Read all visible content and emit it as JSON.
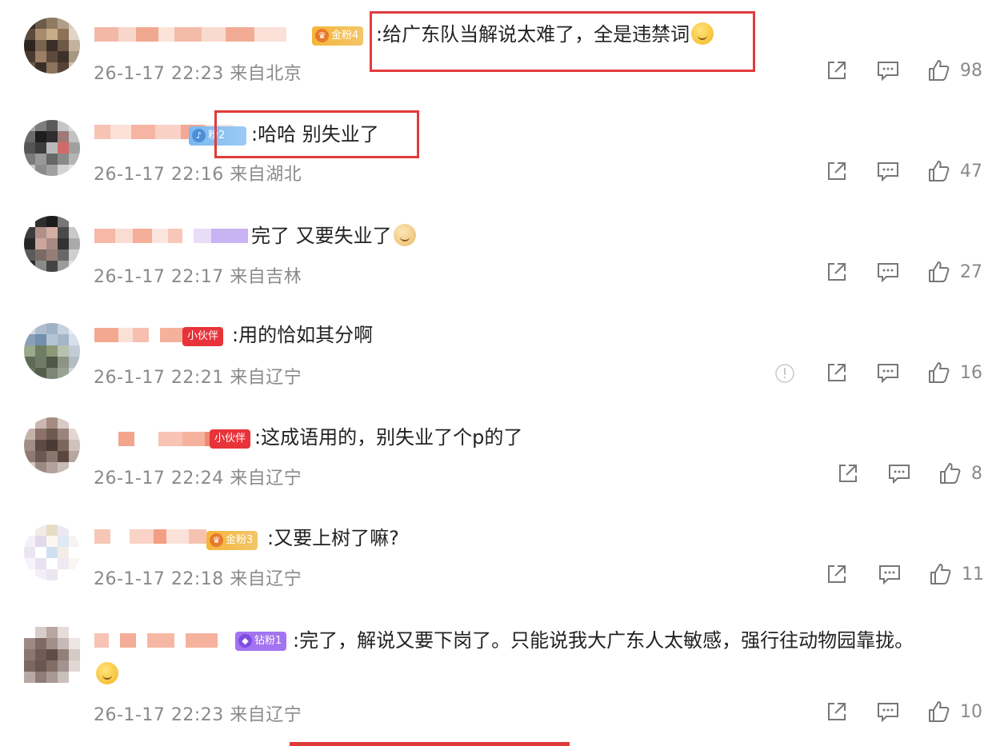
{
  "comments": [
    {
      "badge": "金粉4",
      "text": ":给广东队当解说太难了，全是违禁词",
      "time": "26-1-17 22:23",
      "location": "来自北京",
      "likes": "98"
    },
    {
      "badge": "粉2",
      "text": ":哈哈 别失业了",
      "time": "26-1-17 22:16",
      "location": "来自湖北",
      "likes": "47"
    },
    {
      "badge": "",
      "text": "完了 又要失业了",
      "time": "26-1-17 22:17",
      "location": "来自吉林",
      "likes": "27"
    },
    {
      "badge": "小伙伴",
      "text": ":用的恰如其分啊",
      "time": "26-1-17 22:21",
      "location": "来自辽宁",
      "likes": "16"
    },
    {
      "badge": "小伙伴",
      "text": ":这成语用的，别失业了个p的了",
      "time": "26-1-17 22:24",
      "location": "来自辽宁",
      "likes": "8"
    },
    {
      "badge": "金粉3",
      "text": ":又要上树了嘛?",
      "time": "26-1-17 22:18",
      "location": "来自辽宁",
      "likes": "11"
    },
    {
      "badge": "钻粉1",
      "text": ":完了，解说又要下岗了。只能说我大广东人太敏感，强行往动物园靠拢。",
      "time": "26-1-17 22:23",
      "location": "来自辽宁",
      "likes": "10"
    }
  ],
  "icons": {
    "share": "share-icon",
    "comment": "comment-icon",
    "like": "thumbs-up-icon",
    "report": "report-icon"
  },
  "colors": {
    "highlight": "#e23b3b",
    "meta_text": "#8a8a8a",
    "body_text": "#222222"
  }
}
